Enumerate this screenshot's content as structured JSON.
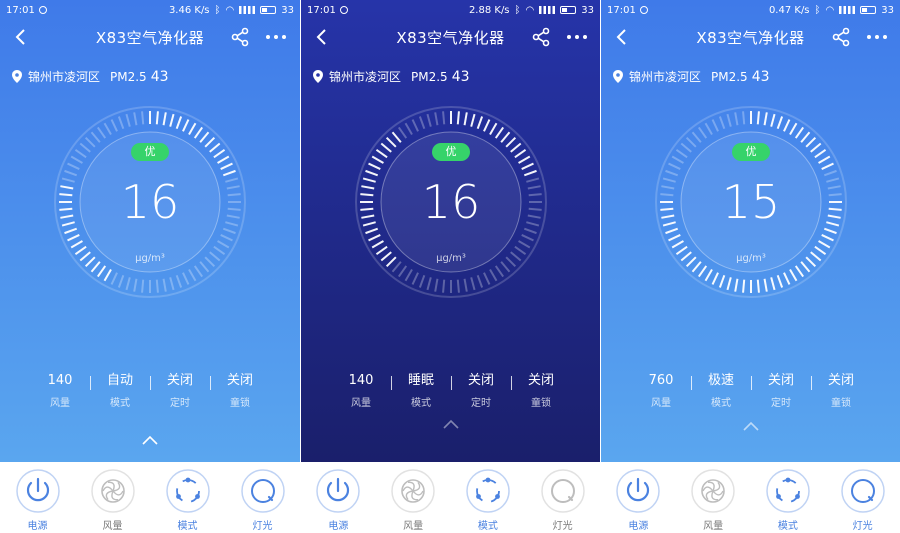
{
  "screens": [
    {
      "bg": [
        "#3f7ae9",
        "#5aa6ef"
      ],
      "status": {
        "time": "17:01",
        "speed": "3.46 K/s",
        "battery": "33"
      },
      "nav": {
        "title": "X83空气净化器"
      },
      "location": {
        "city": "锦州市凌河区",
        "pm_label": "PM2.5",
        "pm_value": "43"
      },
      "gauge": {
        "badge": "优",
        "value": "16",
        "unit": "μg/m³",
        "level": 0.2,
        "fill_start": 0.58,
        "fill_end": 0.78
      },
      "stats": [
        {
          "value": "140",
          "label": "风量"
        },
        {
          "value": "自动",
          "label": "模式"
        },
        {
          "value": "关闭",
          "label": "定时"
        },
        {
          "value": "关闭",
          "label": "童锁"
        }
      ],
      "buttons": [
        {
          "label": "电源",
          "icon": "power-icon",
          "on": true
        },
        {
          "label": "风量",
          "icon": "fan-icon",
          "on": false
        },
        {
          "label": "模式",
          "icon": "mode-icon",
          "on": true
        },
        {
          "label": "灯光",
          "icon": "light-icon",
          "on": true
        }
      ]
    },
    {
      "bg": [
        "#2634a9",
        "#1a1f6b"
      ],
      "status": {
        "time": "17:01",
        "speed": "2.88 K/s",
        "battery": "33"
      },
      "nav": {
        "title": "X83空气净化器"
      },
      "location": {
        "city": "锦州市凌河区",
        "pm_label": "PM2.5",
        "pm_value": "43"
      },
      "gauge": {
        "badge": "优",
        "value": "16",
        "unit": "μg/m³",
        "level": 0.2,
        "fill_start": 0.62,
        "fill_end": 0.9
      },
      "stats": [
        {
          "value": "140",
          "label": "风量"
        },
        {
          "value": "睡眠",
          "label": "模式"
        },
        {
          "value": "关闭",
          "label": "定时"
        },
        {
          "value": "关闭",
          "label": "童锁"
        }
      ],
      "buttons": [
        {
          "label": "电源",
          "icon": "power-icon",
          "on": true
        },
        {
          "label": "风量",
          "icon": "fan-icon",
          "on": false
        },
        {
          "label": "模式",
          "icon": "mode-icon",
          "on": true
        },
        {
          "label": "灯光",
          "icon": "light-icon",
          "on": false
        }
      ]
    },
    {
      "bg": [
        "#3f7ae9",
        "#5aa6ef"
      ],
      "status": {
        "time": "17:01",
        "speed": "0.47 K/s",
        "battery": "33"
      },
      "nav": {
        "title": "X83空气净化器"
      },
      "location": {
        "city": "锦州市凌河区",
        "pm_label": "PM2.5",
        "pm_value": "43"
      },
      "gauge": {
        "badge": "优",
        "value": "15",
        "unit": "μg/m³",
        "level": 0.19,
        "fill_start": 0.25,
        "fill_end": 0.75
      },
      "stats": [
        {
          "value": "760",
          "label": "风量"
        },
        {
          "value": "极速",
          "label": "模式"
        },
        {
          "value": "关闭",
          "label": "定时"
        },
        {
          "value": "关闭",
          "label": "童锁"
        }
      ],
      "buttons": [
        {
          "label": "电源",
          "icon": "power-icon",
          "on": true
        },
        {
          "label": "风量",
          "icon": "fan-icon",
          "on": false
        },
        {
          "label": "模式",
          "icon": "mode-icon",
          "on": true
        },
        {
          "label": "灯光",
          "icon": "light-icon",
          "on": true
        }
      ]
    }
  ],
  "colors": {
    "accent": "#4b82e0",
    "good": "#36d36a",
    "inactive": "#bdbdbd"
  }
}
